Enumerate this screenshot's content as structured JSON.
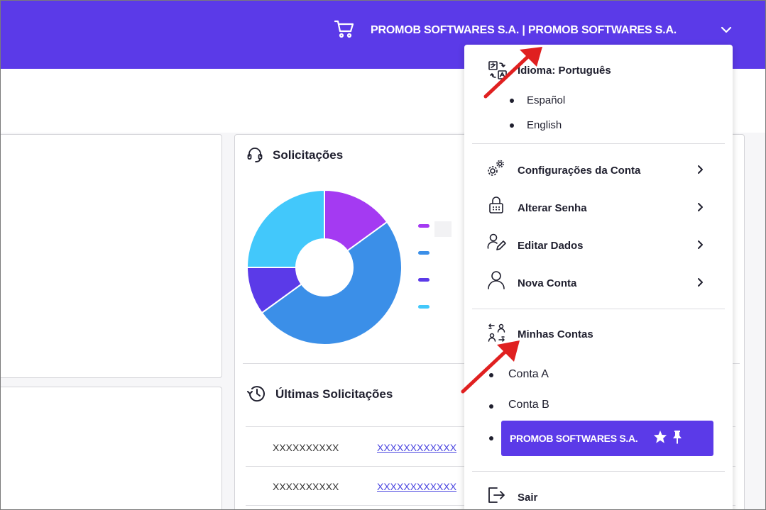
{
  "header": {
    "account_name": "PROMOB SOFTWARES S.A. | PROMOB SOFTWARES S.A."
  },
  "requests_card": {
    "title": "Solicitações",
    "chart_data": {
      "type": "pie",
      "donut": true,
      "slices": [
        {
          "value": 15,
          "color": "#a43af2"
        },
        {
          "value": 50,
          "color": "#3b8fe8"
        },
        {
          "value": 10,
          "color": "#5b3ae8"
        },
        {
          "value": 25,
          "color": "#42c8fb"
        }
      ],
      "legend_colors": [
        "#a43af2",
        "#3b8fe8",
        "#5b3ae8",
        "#42c8fb"
      ]
    }
  },
  "latest_card": {
    "title": "Últimas Solicitações",
    "rows": [
      {
        "id": "XXXXXXXXXX",
        "link": "XXXXXXXXXXXX"
      },
      {
        "id": "XXXXXXXXXX",
        "link": "XXXXXXXXXXXX"
      }
    ]
  },
  "menu": {
    "language_label": "Idioma: Português",
    "languages": [
      "Español",
      "English"
    ],
    "items": [
      {
        "label": "Configurações da Conta",
        "icon": "gears-icon"
      },
      {
        "label": "Alterar Senha",
        "icon": "lock-icon"
      },
      {
        "label": "Editar Dados",
        "icon": "user-edit-icon"
      },
      {
        "label": "Nova Conta",
        "icon": "user-icon"
      }
    ],
    "my_accounts_label": "Minhas Contas",
    "accounts": [
      "Conta A",
      "Conta B"
    ],
    "active_account": "PROMOB SOFTWARES S.A.",
    "logout_label": "Sair"
  },
  "colors": {
    "brand": "#5b3ae8",
    "annotation_arrow": "#e02020"
  }
}
